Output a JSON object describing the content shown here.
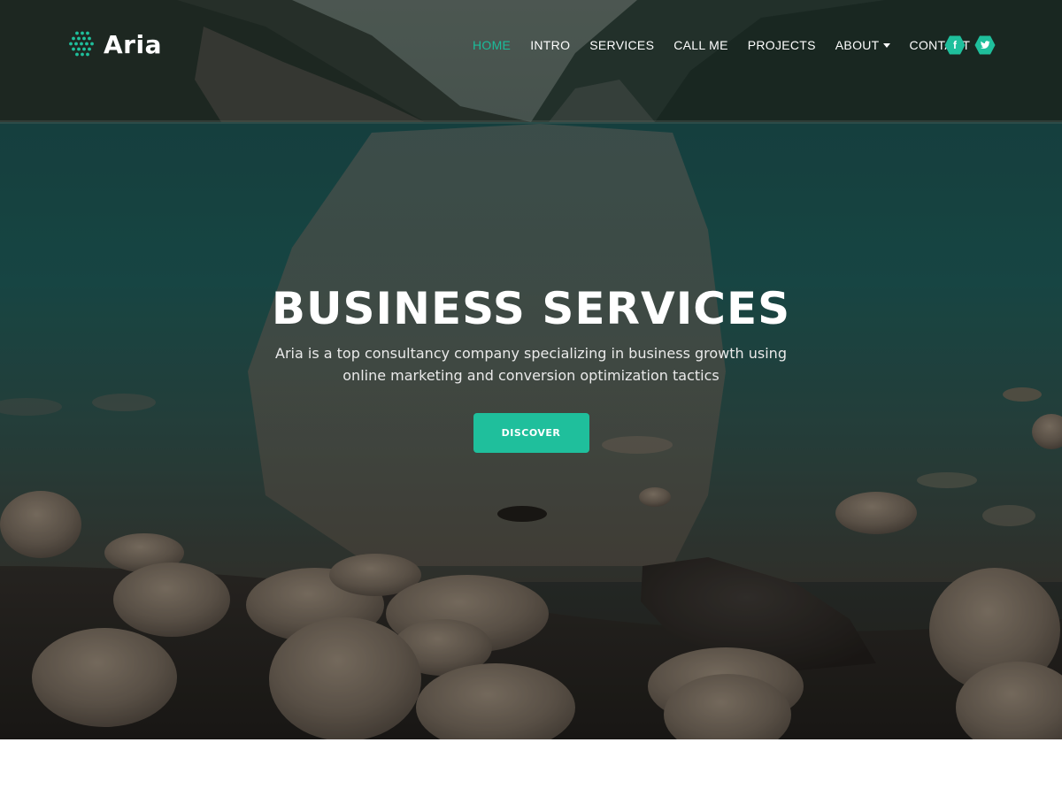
{
  "brand": {
    "name": "Aria",
    "accent_color": "#1fbf9c"
  },
  "nav": {
    "items": [
      {
        "label": "HOME",
        "active": true
      },
      {
        "label": "INTRO"
      },
      {
        "label": "SERVICES"
      },
      {
        "label": "CALL ME"
      },
      {
        "label": "PROJECTS"
      },
      {
        "label": "ABOUT",
        "has_dropdown": true
      },
      {
        "label": "CONTACT"
      }
    ],
    "socials": [
      {
        "icon": "facebook-icon",
        "glyph": "f"
      },
      {
        "icon": "twitter-icon",
        "glyph": "t"
      }
    ]
  },
  "hero": {
    "title": "BUSINESS SERVICES",
    "subtitle": "Aria is a top consultancy company specializing in business growth using online marketing and conversion optimization tactics",
    "cta_label": "DISCOVER",
    "background": "mountain-lake-rocks-photo"
  }
}
